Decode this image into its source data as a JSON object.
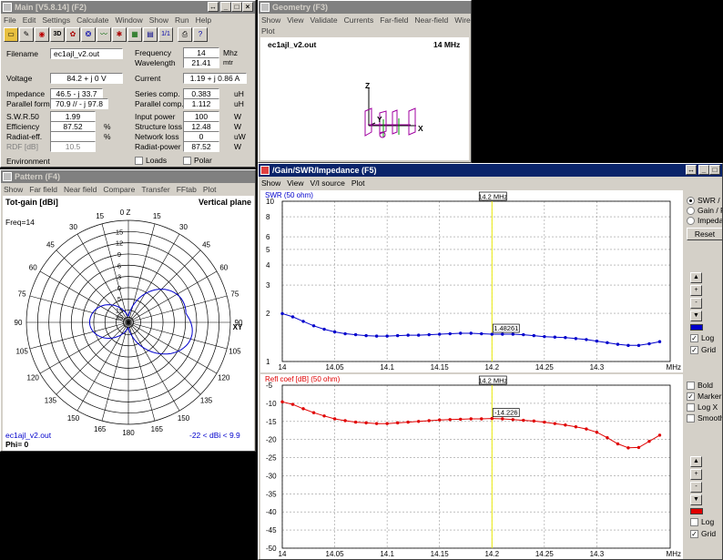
{
  "main_window": {
    "title": "Main [V5.8.14]  (F2)",
    "menu": [
      "File",
      "Edit",
      "Settings",
      "Calculate",
      "Window",
      "Show",
      "Run",
      "Help"
    ],
    "filename_label": "Filename",
    "filename_value": "ec1ajl_v2.out",
    "frequency_label": "Frequency",
    "frequency_value": "14",
    "frequency_unit": "Mhz",
    "wavelength_label": "Wavelength",
    "wavelength_value": "21.41",
    "wavelength_unit": "mtr",
    "voltage_label": "Voltage",
    "voltage_value": "84.2 + j 0 V",
    "current_label": "Current",
    "current_value": "1.19 + j 0.86 A",
    "impedance_label": "Impedance",
    "impedance_value": "46.5 - j 33.7",
    "series_comp_label": "Series comp.",
    "series_comp_value": "0.383",
    "series_comp_unit": "uH",
    "parallel_form_label": "Parallel form",
    "parallel_form_value": "70.9 // - j 97.8",
    "parallel_comp_label": "Parallel comp.",
    "parallel_comp_value": "1.112",
    "parallel_comp_unit": "uH",
    "swr_label": "S.W.R.50",
    "swr_value": "1.99",
    "input_power_label": "Input power",
    "input_power_value": "100",
    "input_power_unit": "W",
    "efficiency_label": "Efficiency",
    "efficiency_value": "87.52",
    "efficiency_unit": "%",
    "structure_loss_label": "Structure loss",
    "structure_loss_value": "12.48",
    "structure_loss_unit": "W",
    "radiat_eff_label": "Radiat-eff.",
    "radiat_eff_value": "",
    "radiat_eff_unit": "%",
    "network_loss_label": "Network loss",
    "network_loss_value": "0",
    "network_loss_unit": "uW",
    "rdf_label": "RDF [dB]",
    "rdf_value": "10.5",
    "radiat_power_label": "Radiat-power",
    "radiat_power_value": "87.52",
    "radiat_power_unit": "W",
    "environment_label": "Environment",
    "loads_label": "Loads",
    "polar_label": "Polar"
  },
  "geometry_window": {
    "title": "Geometry  (F3)",
    "menu": [
      "Show",
      "View",
      "Validate",
      "Currents",
      "Far-field",
      "Near-field",
      "Wire"
    ],
    "menu2": [
      "Plot"
    ],
    "filename": "ec1ajl_v2.out",
    "freq": "14 MHz",
    "axis_z": "Z",
    "axis_y": "Y",
    "axis_x": "X"
  },
  "pattern_window": {
    "title": "Pattern  (F4)",
    "menu": [
      "Show",
      "Far field",
      "Near field",
      "Compare",
      "Transfer",
      "FFtab",
      "Plot"
    ],
    "tot_gain": "Tot-gain [dBi]",
    "plane": "Vertical plane",
    "freq": "Freq=14",
    "filename": "ec1ajl_v2.out",
    "phi": "Phi= 0",
    "range": "-22 < dBi < 9.9",
    "angle_labels": [
      "0",
      "15",
      "30",
      "45",
      "60",
      "75",
      "90",
      "105",
      "120",
      "135",
      "150",
      "165",
      "180",
      "165",
      "150",
      "135",
      "120",
      "105",
      "90",
      "75",
      "60",
      "45",
      "30",
      "15"
    ],
    "ring_labels": [
      "15",
      "12",
      "9",
      "6",
      "3",
      "0",
      "5",
      "15",
      "35"
    ],
    "zenith_label": "Z",
    "xy_label": "XY"
  },
  "gain_window": {
    "title": "/Gain/SWR/Impedance  (F5)",
    "menu": [
      "Show",
      "View",
      "V/I source",
      "Plot"
    ],
    "swr_title": "SWR (50 ohm)",
    "refl_title": "Refl coef [dB] (50 ohm)",
    "marker_label": "14.2 MHz",
    "swr_marker_value": "1.48261",
    "refl_marker_value": "-14.226",
    "unit": "MHz",
    "radio_options": [
      "SWR / r",
      "Gain / F",
      "Impedar"
    ],
    "reset_label": "Reset",
    "log_label": "Log",
    "grid_label": "Grid",
    "bold_label": "Bold",
    "markers_label": "Markers",
    "logx_label": "Log X",
    "smooth_label": "Smooth",
    "swr_color": "#0000cc",
    "refl_color": "#e00000",
    "marker_color": "#e8e800"
  },
  "chart_data": [
    {
      "type": "line",
      "title": "SWR (50 ohm)",
      "xlabel": "MHz",
      "ylabel": "",
      "ylim": [
        1,
        10
      ],
      "yscale": "log",
      "grid": true,
      "x_ticks": [
        "14",
        "14.05",
        "14.1",
        "14.15",
        "14.2",
        "14.25",
        "14.3"
      ],
      "y_ticks": [
        "10",
        "8",
        "6",
        "5",
        "4",
        "3",
        "2",
        "1"
      ],
      "series": [
        {
          "x": [
            14.0,
            14.01,
            14.02,
            14.03,
            14.04,
            14.05,
            14.06,
            14.07,
            14.08,
            14.09,
            14.1,
            14.11,
            14.12,
            14.13,
            14.14,
            14.15,
            14.16,
            14.17,
            14.18,
            14.19,
            14.2,
            14.21,
            14.22,
            14.23,
            14.24,
            14.25,
            14.26,
            14.27,
            14.28,
            14.29,
            14.3,
            14.31,
            14.32,
            14.33,
            14.34,
            14.35,
            14.36
          ],
          "y": [
            1.99,
            1.9,
            1.78,
            1.67,
            1.59,
            1.53,
            1.49,
            1.47,
            1.45,
            1.44,
            1.44,
            1.45,
            1.46,
            1.46,
            1.47,
            1.48,
            1.49,
            1.5,
            1.5,
            1.49,
            1.48,
            1.48,
            1.48,
            1.47,
            1.45,
            1.43,
            1.42,
            1.41,
            1.39,
            1.37,
            1.34,
            1.31,
            1.28,
            1.26,
            1.26,
            1.29,
            1.33
          ]
        }
      ]
    },
    {
      "type": "line",
      "title": "Refl coef [dB] (50 ohm)",
      "xlabel": "MHz",
      "ylabel": "",
      "ylim": [
        -50,
        -5
      ],
      "grid": true,
      "x_ticks": [
        "14",
        "14.05",
        "14.1",
        "14.15",
        "14.2",
        "14.25",
        "14.3"
      ],
      "y_ticks": [
        "-5",
        "-10",
        "-15",
        "-20",
        "-25",
        "-30",
        "-35",
        "-40",
        "-45",
        "-50"
      ],
      "series": [
        {
          "x": [
            14.0,
            14.01,
            14.02,
            14.03,
            14.04,
            14.05,
            14.06,
            14.07,
            14.08,
            14.09,
            14.1,
            14.11,
            14.12,
            14.13,
            14.14,
            14.15,
            14.16,
            14.17,
            14.18,
            14.19,
            14.2,
            14.21,
            14.22,
            14.23,
            14.24,
            14.25,
            14.26,
            14.27,
            14.28,
            14.29,
            14.3,
            14.31,
            14.32,
            14.33,
            14.34,
            14.35,
            14.36
          ],
          "y": [
            -9.6,
            -10.3,
            -11.5,
            -12.6,
            -13.5,
            -14.3,
            -14.8,
            -15.2,
            -15.4,
            -15.6,
            -15.6,
            -15.4,
            -15.2,
            -15.0,
            -14.8,
            -14.6,
            -14.5,
            -14.4,
            -14.3,
            -14.3,
            -14.2,
            -14.3,
            -14.5,
            -14.7,
            -14.9,
            -15.2,
            -15.6,
            -16.0,
            -16.5,
            -17.1,
            -18.0,
            -19.5,
            -21.2,
            -22.3,
            -22.2,
            -20.5,
            -18.8
          ]
        }
      ]
    }
  ]
}
